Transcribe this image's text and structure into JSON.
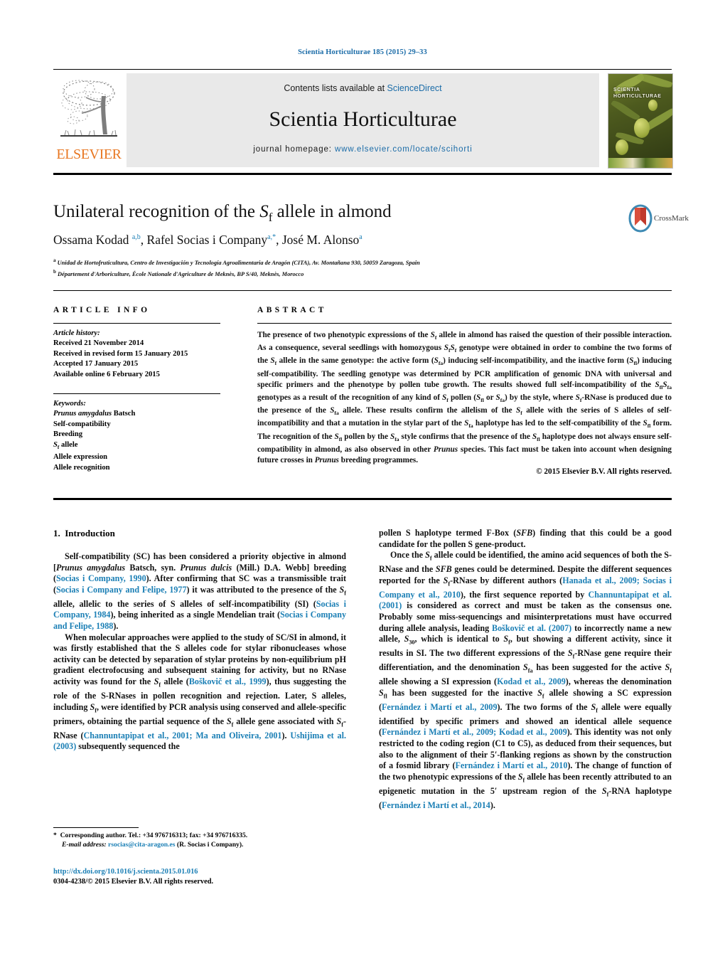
{
  "running_head": "Scientia Horticulturae 185 (2015) 29–33",
  "masthead": {
    "contents_prefix": "Contents lists available at ",
    "contents_link": "ScienceDirect",
    "journal_title": "Scientia Horticulturae",
    "homepage_prefix": "journal homepage: ",
    "homepage_link": "www.elsevier.com/locate/scihorti",
    "publisher": "ELSEVIER",
    "cover_title_line1": "SCIENTIA",
    "cover_title_line2": "HORTICULTURAE",
    "tree_icon": "elsevier-tree-icon"
  },
  "article": {
    "title_pre": "Unilateral recognition of the ",
    "title_italic": "S",
    "title_sub": "f",
    "title_post": " allele in almond",
    "crossmark_label": "CrossMark",
    "authors_html": "Ossama Kodad <sup>a,b</sup>, Rafel Socias i Company<sup>a,*</sup>, José M. Alonso<sup>a</sup>",
    "affiliations": [
      "Unidad de Hortofruticultura, Centro de Investigación y Tecnología Agroalimentaria de Aragón (CITA), Av. Montañana 930, 50059 Zaragoza, Spain",
      "Département d'Arboriculture, École Nationale d'Agriculture de Meknès, BP S/40, Meknès, Morocco"
    ],
    "affil_marks": [
      "a",
      "b"
    ]
  },
  "article_info": {
    "heading": "ARTICLE INFO",
    "history_label": "Article history:",
    "history": [
      "Received 21 November 2014",
      "Received in revised form 15 January 2015",
      "Accepted 17 January 2015",
      "Available online 6 February 2015"
    ],
    "keywords_label": "Keywords:",
    "keywords": [
      "Prunus amygdalus Batsch",
      "Self-compatibility",
      "Breeding",
      "Sf allele",
      "Allele expression",
      "Allele recognition"
    ]
  },
  "abstract": {
    "heading": "ABSTRACT",
    "text": "The presence of two phenotypic expressions of the Sf allele in almond has raised the question of their possible interaction. As a consequence, several seedlings with homozygous SfSf genotype were obtained in order to combine the two forms of the Sf allele in the same genotype: the active form (Sfa) inducing self-incompatibility, and the inactive form (Sfl) inducing self-compatibility. The seedling genotype was determined by PCR amplification of genomic DNA with universal and specific primers and the phenotype by pollen tube growth. The results showed full self-incompatibility of the SflSfa genotypes as a result of the recognition of any kind of Sf pollen (Sfl or Sfa) by the style, where Sf-RNase is produced due to the presence of the Sfa allele. These results confirm the allelism of the Sf allele with the series of S alleles of self-incompatibility and that a mutation in the stylar part of the Sfa haplotype has led to the self-compatibility of the Sfl form. The recognition of the Sfl pollen by the Sfa style confirms that the presence of the Sfl haplotype does not always ensure self-compatibility in almond, as also observed in other Prunus species. This fact must be taken into account when designing future crosses in Prunus breeding programmes.",
    "copyright": "© 2015 Elsevier B.V. All rights reserved."
  },
  "body": {
    "section_number": "1.",
    "section_title": "Introduction",
    "left_paragraphs": [
      "Self-compatibility (SC) has been considered a priority objective in almond [Prunus amygdalus Batsch, syn. Prunus dulcis (Mill.) D.A. Webb] breeding (Socias i Company, 1990). After confirming that SC was a transmissible trait (Socias i Company and Felipe, 1977) it was attributed to the presence of the Sf allele, allelic to the series of S alleles of self-incompatibility (SI) (Socias i Company, 1984), being inherited as a single Mendelian trait (Socias i Company and Felipe, 1988).",
      "When molecular approaches were applied to the study of SC/SI in almond, it was firstly established that the S alleles code for stylar ribonucleases whose activity can be detected by separation of stylar proteins by non-equilibrium pH gradient electrofocusing and subsequent staining for activity, but no RNase activity was found for the Sf allele (Boškovič et al., 1999), thus suggesting the role of the S-RNases in pollen recognition and rejection. Later, S alleles, including Sf, were identified by PCR analysis using conserved and allele-specific primers, obtaining the partial sequence of the Sf allele gene associated with Sf-RNase (Channuntapipat et al., 2001; Ma and Oliveira, 2001). Ushijima et al. (2003) subsequently sequenced the"
    ],
    "right_paragraphs": [
      "pollen S haplotype termed F-Box (SFB) finding that this could be a good candidate for the pollen S gene-product.",
      "Once the Sf allele could be identified, the amino acid sequences of both the S-RNase and the SFB genes could be determined. Despite the different sequences reported for the Sf-RNase by different authors (Hanada et al., 2009; Socias i Company et al., 2010), the first sequence reported by Channuntapipat et al. (2001) is considered as correct and must be taken as the consensus one. Probably some miss-sequencings and misinterpretations must have occurred during allele analysis, leading Boškovič et al. (2007) to incorrectly name a new allele, S30, which is identical to Sf, but showing a different activity, since it results in SI. The two different expressions of the Sf-RNase gene require their differentiation, and the denomination Sfa has been suggested for the active Sf allele showing a SI expression (Kodad et al., 2009), whereas the denomination Sfl has been suggested for the inactive Sf allele showing a SC expression (Fernández i Martí et al., 2009). The two forms of the Sf allele were equally identified by specific primers and showed an identical allele sequence (Fernández i Martí et al., 2009; Kodad et al., 2009). This identity was not only restricted to the coding region (C1 to C5), as deduced from their sequences, but also to the alignment of their 5′-flanking regions as shown by the construction of a fosmid library (Fernández i Martí et al., 2010). The change of function of the two phenotypic expressions of the Sf allele has been recently attributed to an epigenetic mutation in the 5′ upstream region of the Sf-RNA haplotype (Fernández i Martí et al., 2014)."
    ]
  },
  "footer": {
    "corresponding_marker": "*",
    "corresponding": "Corresponding author. Tel.: +34 976716313; fax: +34 976716335.",
    "email_label": "E-mail address:",
    "email": "rsocias@cita-aragon.es",
    "email_suffix": "(R. Socias i Company).",
    "doi": "http://dx.doi.org/10.1016/j.scienta.2015.01.016",
    "issn_line": "0304-4238/© 2015 Elsevier B.V. All rights reserved."
  },
  "colors": {
    "link": "#1b7fb5",
    "elsevier_orange": "#E87722",
    "band_gray": "#e9e9e9"
  }
}
